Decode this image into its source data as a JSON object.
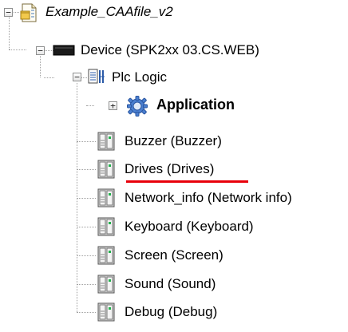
{
  "tree": {
    "root": {
      "label": "Example_CAAfile_v2",
      "expanded": true,
      "icon": "project-file-icon"
    },
    "device": {
      "label": "Device (SPK2xx 03.CS.WEB)",
      "expanded": true,
      "icon": "device-icon"
    },
    "plc_logic": {
      "label": "Plc Logic",
      "expanded": true,
      "icon": "plc-logic-icon"
    },
    "application": {
      "label": "Application",
      "expanded": false,
      "icon": "gear-icon"
    },
    "modules": [
      {
        "label": "Buzzer (Buzzer)",
        "icon": "module-icon"
      },
      {
        "label": "Drives (Drives)",
        "icon": "module-icon",
        "highlighted": true
      },
      {
        "label": "Network_info (Network info)",
        "icon": "module-icon"
      },
      {
        "label": "Keyboard (Keyboard)",
        "icon": "module-icon"
      },
      {
        "label": "Screen (Screen)",
        "icon": "module-icon"
      },
      {
        "label": "Sound (Sound)",
        "icon": "module-icon"
      },
      {
        "label": "Debug (Debug)",
        "icon": "module-icon"
      }
    ],
    "expand_symbol": "+",
    "collapse_symbol": "−"
  },
  "colors": {
    "highlight_underline": "#e8000b",
    "tree_lines": "#a0a0a0"
  }
}
